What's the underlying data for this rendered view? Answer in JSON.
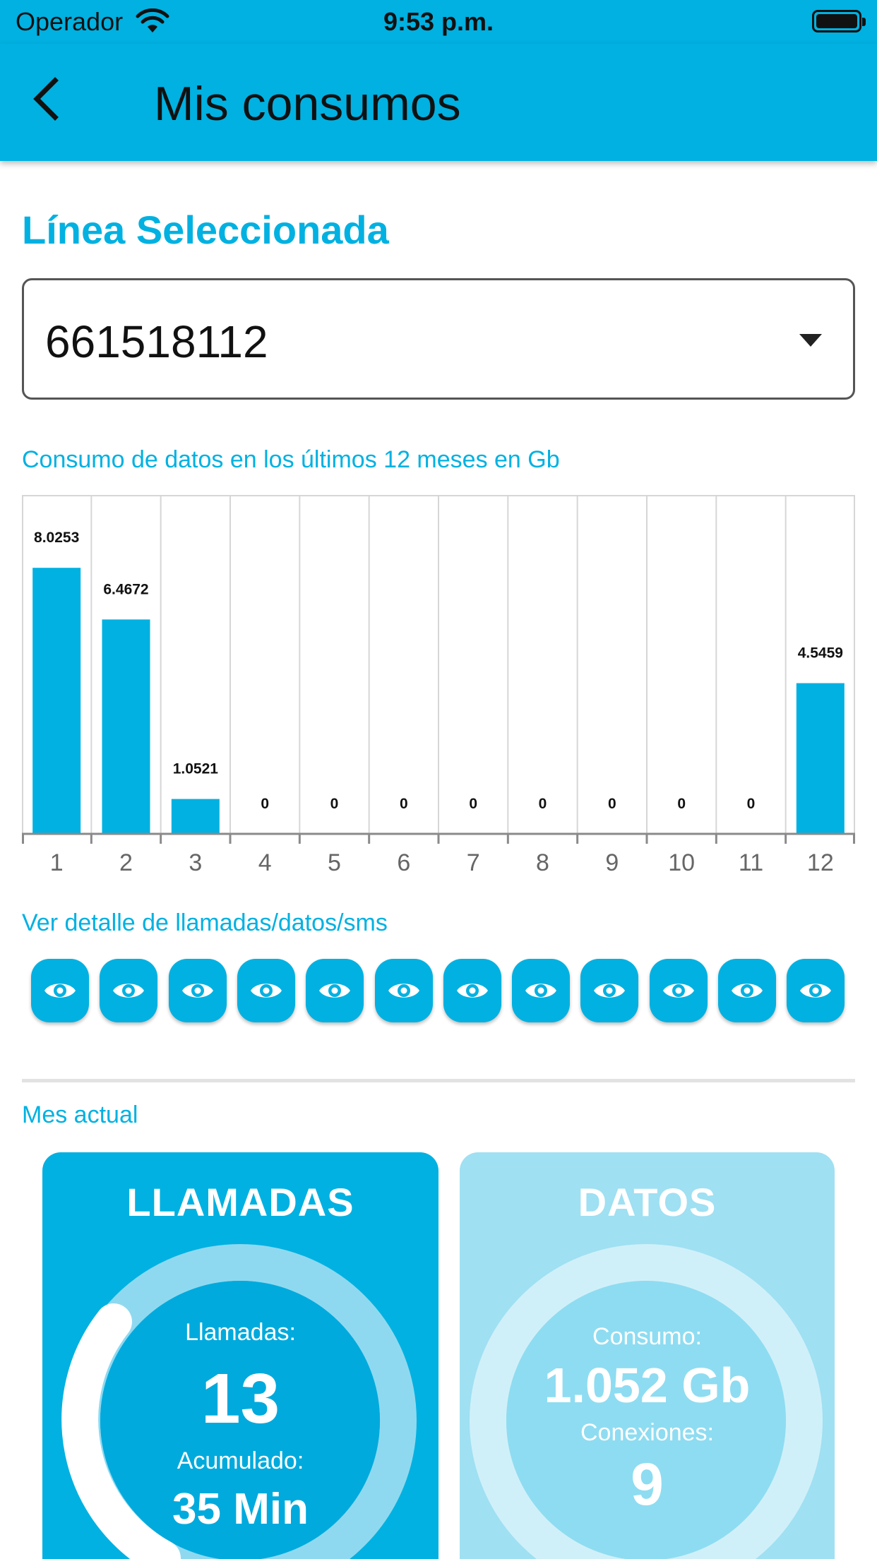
{
  "status_bar": {
    "carrier": "Operador",
    "time": "9:53 p.m."
  },
  "header": {
    "title": "Mis consumos",
    "back_icon": "chevron-left-icon"
  },
  "line_selector": {
    "title": "Línea Seleccionada",
    "selected_value": "661518112",
    "dropdown_icon": "caret-down-icon"
  },
  "chart_caption": "Consumo de datos en los últimos 12 meses en Gb",
  "chart_data": {
    "type": "bar",
    "categories": [
      "1",
      "2",
      "3",
      "4",
      "5",
      "6",
      "7",
      "8",
      "9",
      "10",
      "11",
      "12"
    ],
    "values": [
      8.0253,
      6.4672,
      1.0521,
      0,
      0,
      0,
      0,
      0,
      0,
      0,
      0,
      4.5459
    ],
    "data_labels": [
      "8.0253",
      "6.4672",
      "1.0521",
      "0",
      "0",
      "0",
      "0",
      "0",
      "0",
      "0",
      "0",
      "4.5459"
    ],
    "title": "",
    "xlabel": "",
    "ylabel": "",
    "grid": true,
    "bar_color": "#00b1e1"
  },
  "detail": {
    "caption": "Ver detalle de llamadas/datos/sms",
    "button_icon": "eye-icon",
    "button_count": 12
  },
  "current_month": {
    "caption": "Mes actual",
    "calls": {
      "title": "LLAMADAS",
      "count_label": "Llamadas:",
      "count_value": "13",
      "accum_label": "Acumulado:",
      "accum_value": "35 Min"
    },
    "data": {
      "title": "DATOS",
      "consumption_label": "Consumo:",
      "consumption_value": "1.052 Gb",
      "connections_label": "Conexiones:",
      "connections_value": "9"
    }
  },
  "colors": {
    "accent": "#00b1e1",
    "accent_light": "#9fe0f2"
  }
}
